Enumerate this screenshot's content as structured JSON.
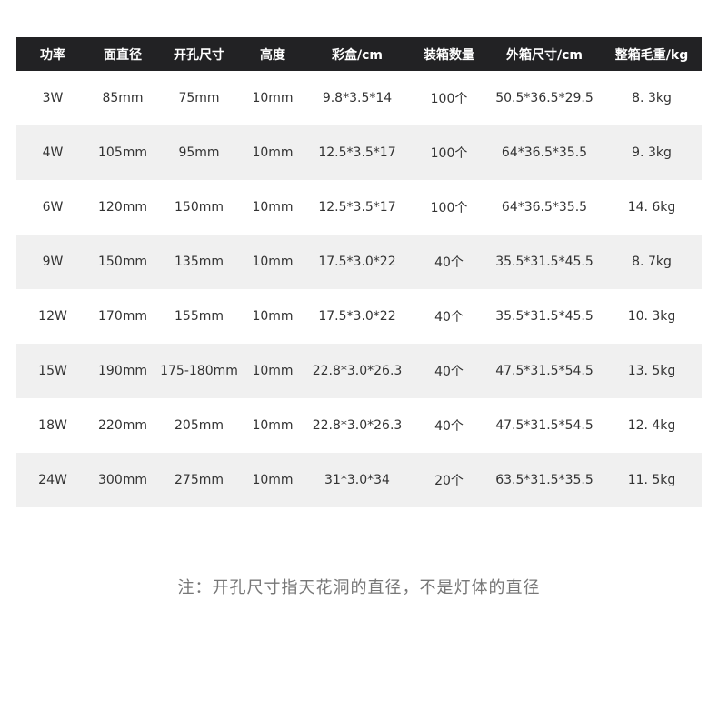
{
  "table": {
    "headers": [
      "功率",
      "面直径",
      "开孔尺寸",
      "高度",
      "彩盒/cm",
      "装箱数量",
      "外箱尺寸/cm",
      "整箱毛重/kg"
    ],
    "rows": [
      [
        "3W",
        "85mm",
        "75mm",
        "10mm",
        "9.8*3.5*14",
        "100个",
        "50.5*36.5*29.5",
        "8. 3kg"
      ],
      [
        "4W",
        "105mm",
        "95mm",
        "10mm",
        "12.5*3.5*17",
        "100个",
        "64*36.5*35.5",
        "9. 3kg"
      ],
      [
        "6W",
        "120mm",
        "150mm",
        "10mm",
        "12.5*3.5*17",
        "100个",
        "64*36.5*35.5",
        "14. 6kg"
      ],
      [
        "9W",
        "150mm",
        "135mm",
        "10mm",
        "17.5*3.0*22",
        "40个",
        "35.5*31.5*45.5",
        "8. 7kg"
      ],
      [
        "12W",
        "170mm",
        "155mm",
        "10mm",
        "17.5*3.0*22",
        "40个",
        "35.5*31.5*45.5",
        "10. 3kg"
      ],
      [
        "15W",
        "190mm",
        "175-180mm",
        "10mm",
        "22.8*3.0*26.3",
        "40个",
        "47.5*31.5*54.5",
        "13. 5kg"
      ],
      [
        "18W",
        "220mm",
        "205mm",
        "10mm",
        "22.8*3.0*26.3",
        "40个",
        "47.5*31.5*54.5",
        "12. 4kg"
      ],
      [
        "24W",
        "300mm",
        "275mm",
        "10mm",
        "31*3.0*34",
        "20个",
        "63.5*31.5*35.5",
        "11. 5kg"
      ]
    ]
  },
  "note": "注：开孔尺寸指天花洞的直径，不是灯体的直径"
}
